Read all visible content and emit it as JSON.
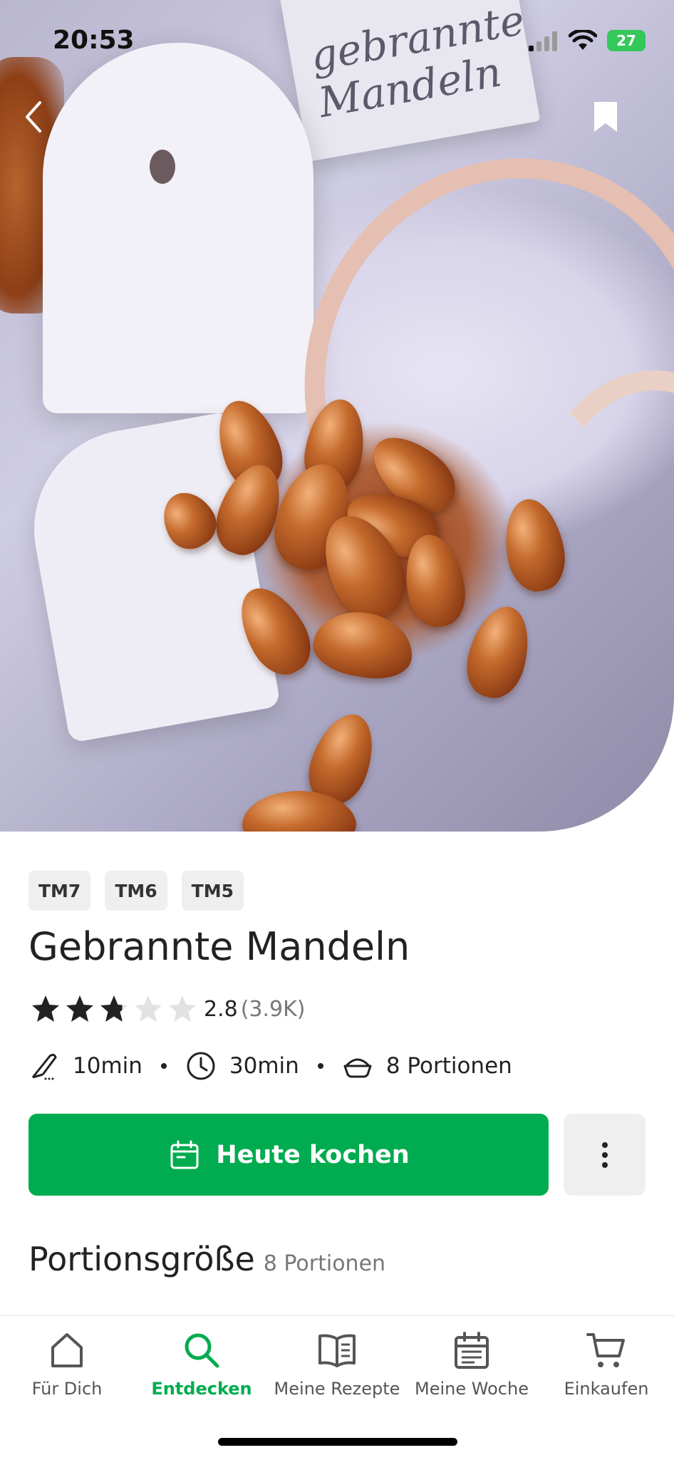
{
  "status_bar": {
    "time": "20:53",
    "battery": "27"
  },
  "hero": {
    "image_description_text": "gebrannte\nMandeln"
  },
  "recipe": {
    "badges": [
      "TM7",
      "TM6",
      "TM5"
    ],
    "title": "Gebrannte Mandeln",
    "rating": {
      "value": "2.8",
      "count": "(3.9K)",
      "stars": 2.8
    },
    "meta": {
      "prep_time": "10min",
      "total_time": "30min",
      "portions": "8 Portionen"
    },
    "cook_button": "Heute kochen",
    "portion_section": {
      "title": "Portionsgröße",
      "value": "8 Portionen"
    }
  },
  "bottom_nav": {
    "items": [
      {
        "label": "Für Dich",
        "icon": "home-icon"
      },
      {
        "label": "Entdecken",
        "icon": "search-icon",
        "active": true
      },
      {
        "label": "Meine Rezepte",
        "icon": "book-icon"
      },
      {
        "label": "Meine Woche",
        "icon": "calendar-icon"
      },
      {
        "label": "Einkaufen",
        "icon": "cart-icon"
      }
    ]
  },
  "colors": {
    "accent": "#00ac4f",
    "badge_bg": "#efefef"
  }
}
